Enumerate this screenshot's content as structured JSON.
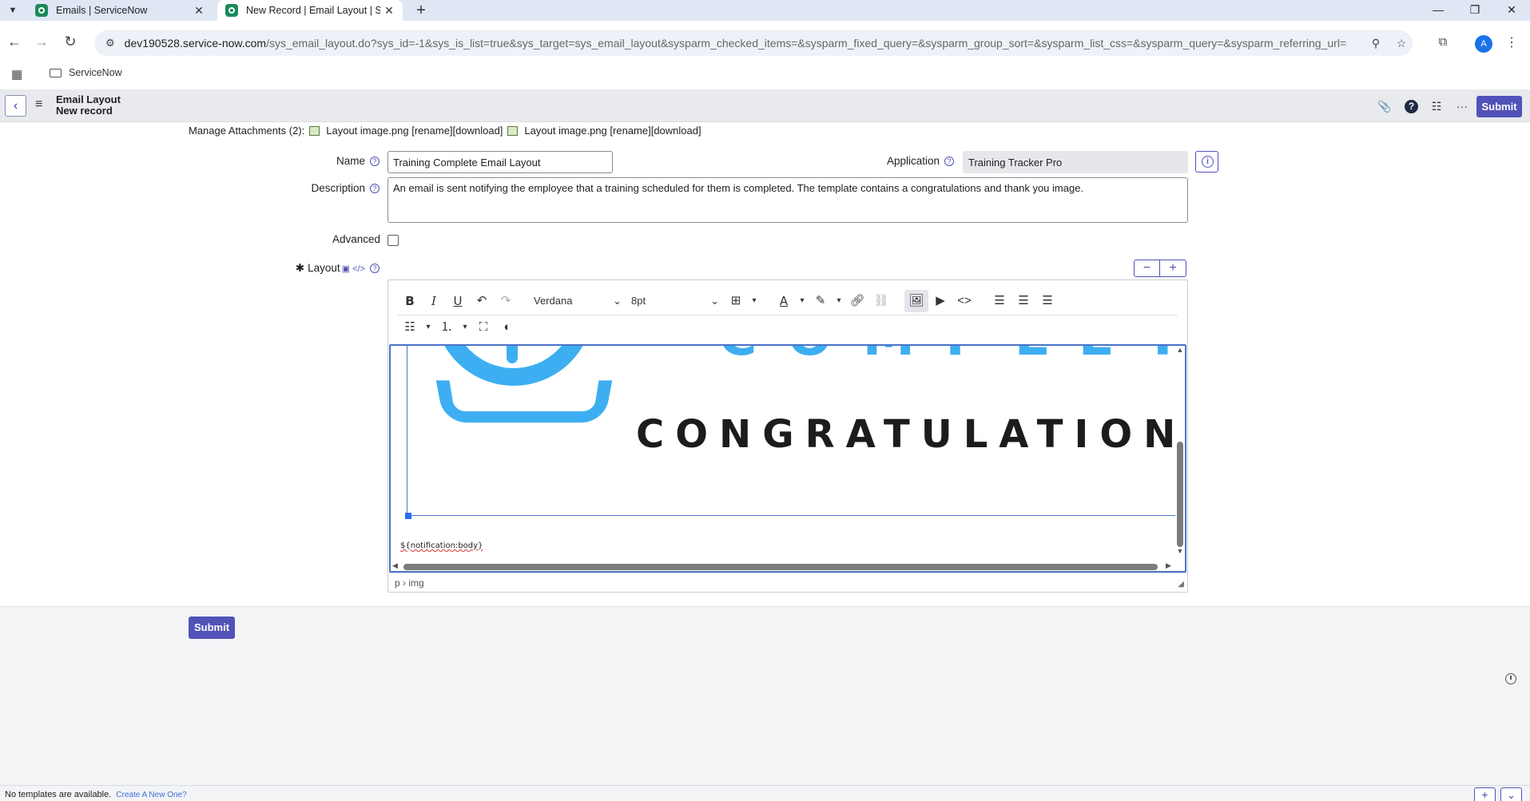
{
  "browser": {
    "tabs": [
      {
        "title": "Emails | ServiceNow"
      },
      {
        "title": "New Record | Email Layout | Se"
      }
    ],
    "url_host": "dev190528.service-now.com",
    "url_path": "/sys_email_layout.do?sys_id=-1&sys_is_list=true&sys_target=sys_email_layout&sysparm_checked_items=&sysparm_fixed_query=&sysparm_group_sort=&sysparm_list_css=&sysparm_query=&sysparm_referring_url=sys_e...",
    "profile_initial": "A",
    "bookmark": "ServiceNow"
  },
  "header": {
    "title_line1": "Email Layout",
    "title_line2": "New record",
    "submit_label": "Submit"
  },
  "attachments": {
    "prefix": "Manage Attachments (2):",
    "items": [
      {
        "name": "Layout image.png",
        "actions": "[rename][download]"
      },
      {
        "name": "Layout image.png",
        "actions": "[rename][download]"
      }
    ]
  },
  "form": {
    "name_label": "Name",
    "name_value": "Training Complete Email Layout",
    "application_label": "Application",
    "application_value": "Training Tracker Pro",
    "description_label": "Description",
    "description_value": "An email is sent notifying the employee that a training scheduled for them is completed. The template contains a congratulations and thank you image.",
    "advanced_label": "Advanced",
    "advanced_checked": false,
    "layout_label": "Layout"
  },
  "editor": {
    "font_family": "Verdana",
    "font_size": "8pt",
    "image_text_top": "COMPLETE",
    "image_text_main": "CONGRATULATIONS!",
    "body_placeholder": "${notification:body}",
    "path": "p › img"
  },
  "footer": {
    "submit_label": "Submit",
    "templates_text": "No templates are available.",
    "templates_link": "Create A New One?"
  },
  "colors": {
    "accent": "#5152b8",
    "image_blue": "#3daef1"
  }
}
